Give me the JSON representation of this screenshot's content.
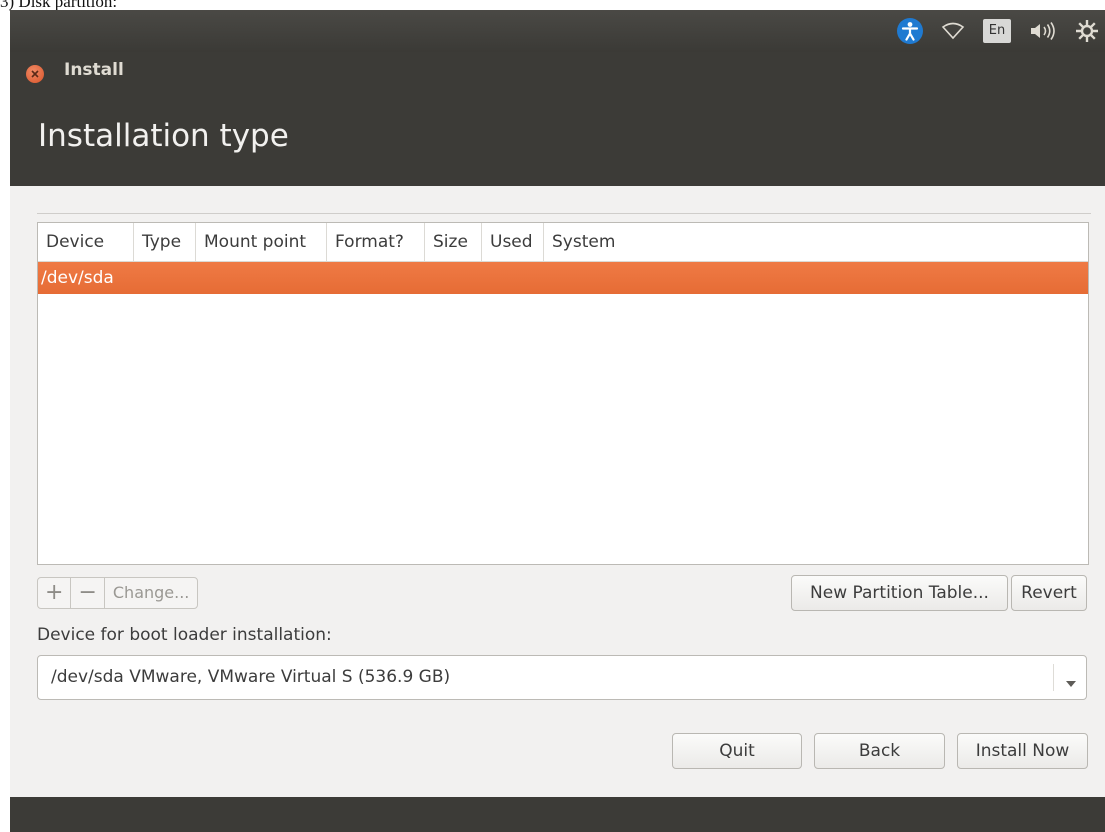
{
  "caption": "3)  Disk partition:",
  "window": {
    "title": "Install",
    "page_title": "Installation type"
  },
  "tray": {
    "language": "En"
  },
  "table": {
    "columns": [
      "Device",
      "Type",
      "Mount point",
      "Format?",
      "Size",
      "Used",
      "System"
    ],
    "rows": [
      {
        "device": "/dev/sda"
      }
    ]
  },
  "partition_actions": {
    "add": "+",
    "remove": "−",
    "change": "Change..."
  },
  "new_partition_table_label": "New Partition Table...",
  "revert_label": "Revert",
  "bootloader": {
    "label": "Device for boot loader installation:",
    "selected": "/dev/sda  VMware, VMware Virtual S (536.9 GB)"
  },
  "nav": {
    "quit": "Quit",
    "back": "Back",
    "install_now": "Install Now"
  },
  "colors": {
    "accent": "#E8703A",
    "header": "#3C3B37",
    "panel": "#43423E",
    "content_bg": "#F2F1F0"
  },
  "icons": [
    "accessibility-icon",
    "network-icon",
    "keyboard-language-icon",
    "volume-icon",
    "settings-gear-icon",
    "close-icon",
    "dropdown-arrow-icon"
  ]
}
